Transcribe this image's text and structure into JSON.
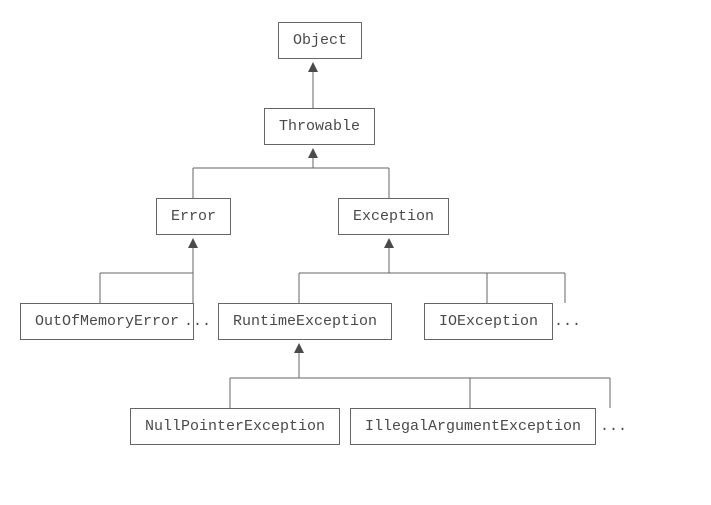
{
  "chart_data": {
    "type": "tree",
    "title": "",
    "nodes": [
      {
        "id": "object",
        "label": "Object",
        "parent": null
      },
      {
        "id": "throwable",
        "label": "Throwable",
        "parent": "object"
      },
      {
        "id": "error",
        "label": "Error",
        "parent": "throwable",
        "has_more_siblings": false
      },
      {
        "id": "exception",
        "label": "Exception",
        "parent": "throwable",
        "has_more_siblings": false
      },
      {
        "id": "outofmemoryerror",
        "label": "OutOfMemoryError",
        "parent": "error",
        "has_more_siblings": true
      },
      {
        "id": "runtimeexception",
        "label": "RuntimeException",
        "parent": "exception",
        "has_more_siblings": false
      },
      {
        "id": "ioexception",
        "label": "IOException",
        "parent": "exception",
        "has_more_siblings": true
      },
      {
        "id": "nullpointerexception",
        "label": "NullPointerException",
        "parent": "runtimeexception",
        "has_more_siblings": false
      },
      {
        "id": "illegalargumentexception",
        "label": "IllegalArgumentException",
        "parent": "runtimeexception",
        "has_more_siblings": true
      }
    ]
  },
  "ellipsis": "..."
}
